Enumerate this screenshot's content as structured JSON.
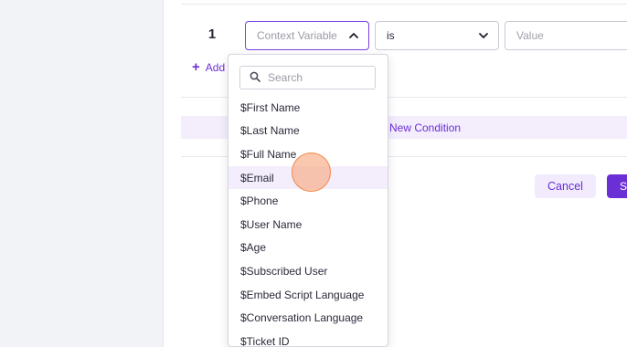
{
  "condition_row": {
    "index": "1",
    "context_select": {
      "placeholder": "Context Variable",
      "expanded": true
    },
    "operator_select": {
      "value": "is"
    },
    "value_select": {
      "placeholder": "Value"
    }
  },
  "add_link": {
    "label": "Add"
  },
  "new_condition": {
    "label": "New Condition"
  },
  "actions": {
    "cancel_label": "Cancel",
    "save_label": "S"
  },
  "dropdown": {
    "search_placeholder": "Search",
    "hovered_item": "$Email",
    "items": [
      "$First Name",
      "$Last Name",
      "$Full Name",
      "$Email",
      "$Phone",
      "$User Name",
      "$Age",
      "$Subscribed User",
      "$Embed Script Language",
      "$Conversation Language",
      "$Ticket ID"
    ]
  },
  "colors": {
    "accent": "#6b2fd6",
    "accent_light": "#f3edfc",
    "cursor": "#f08a4b"
  }
}
